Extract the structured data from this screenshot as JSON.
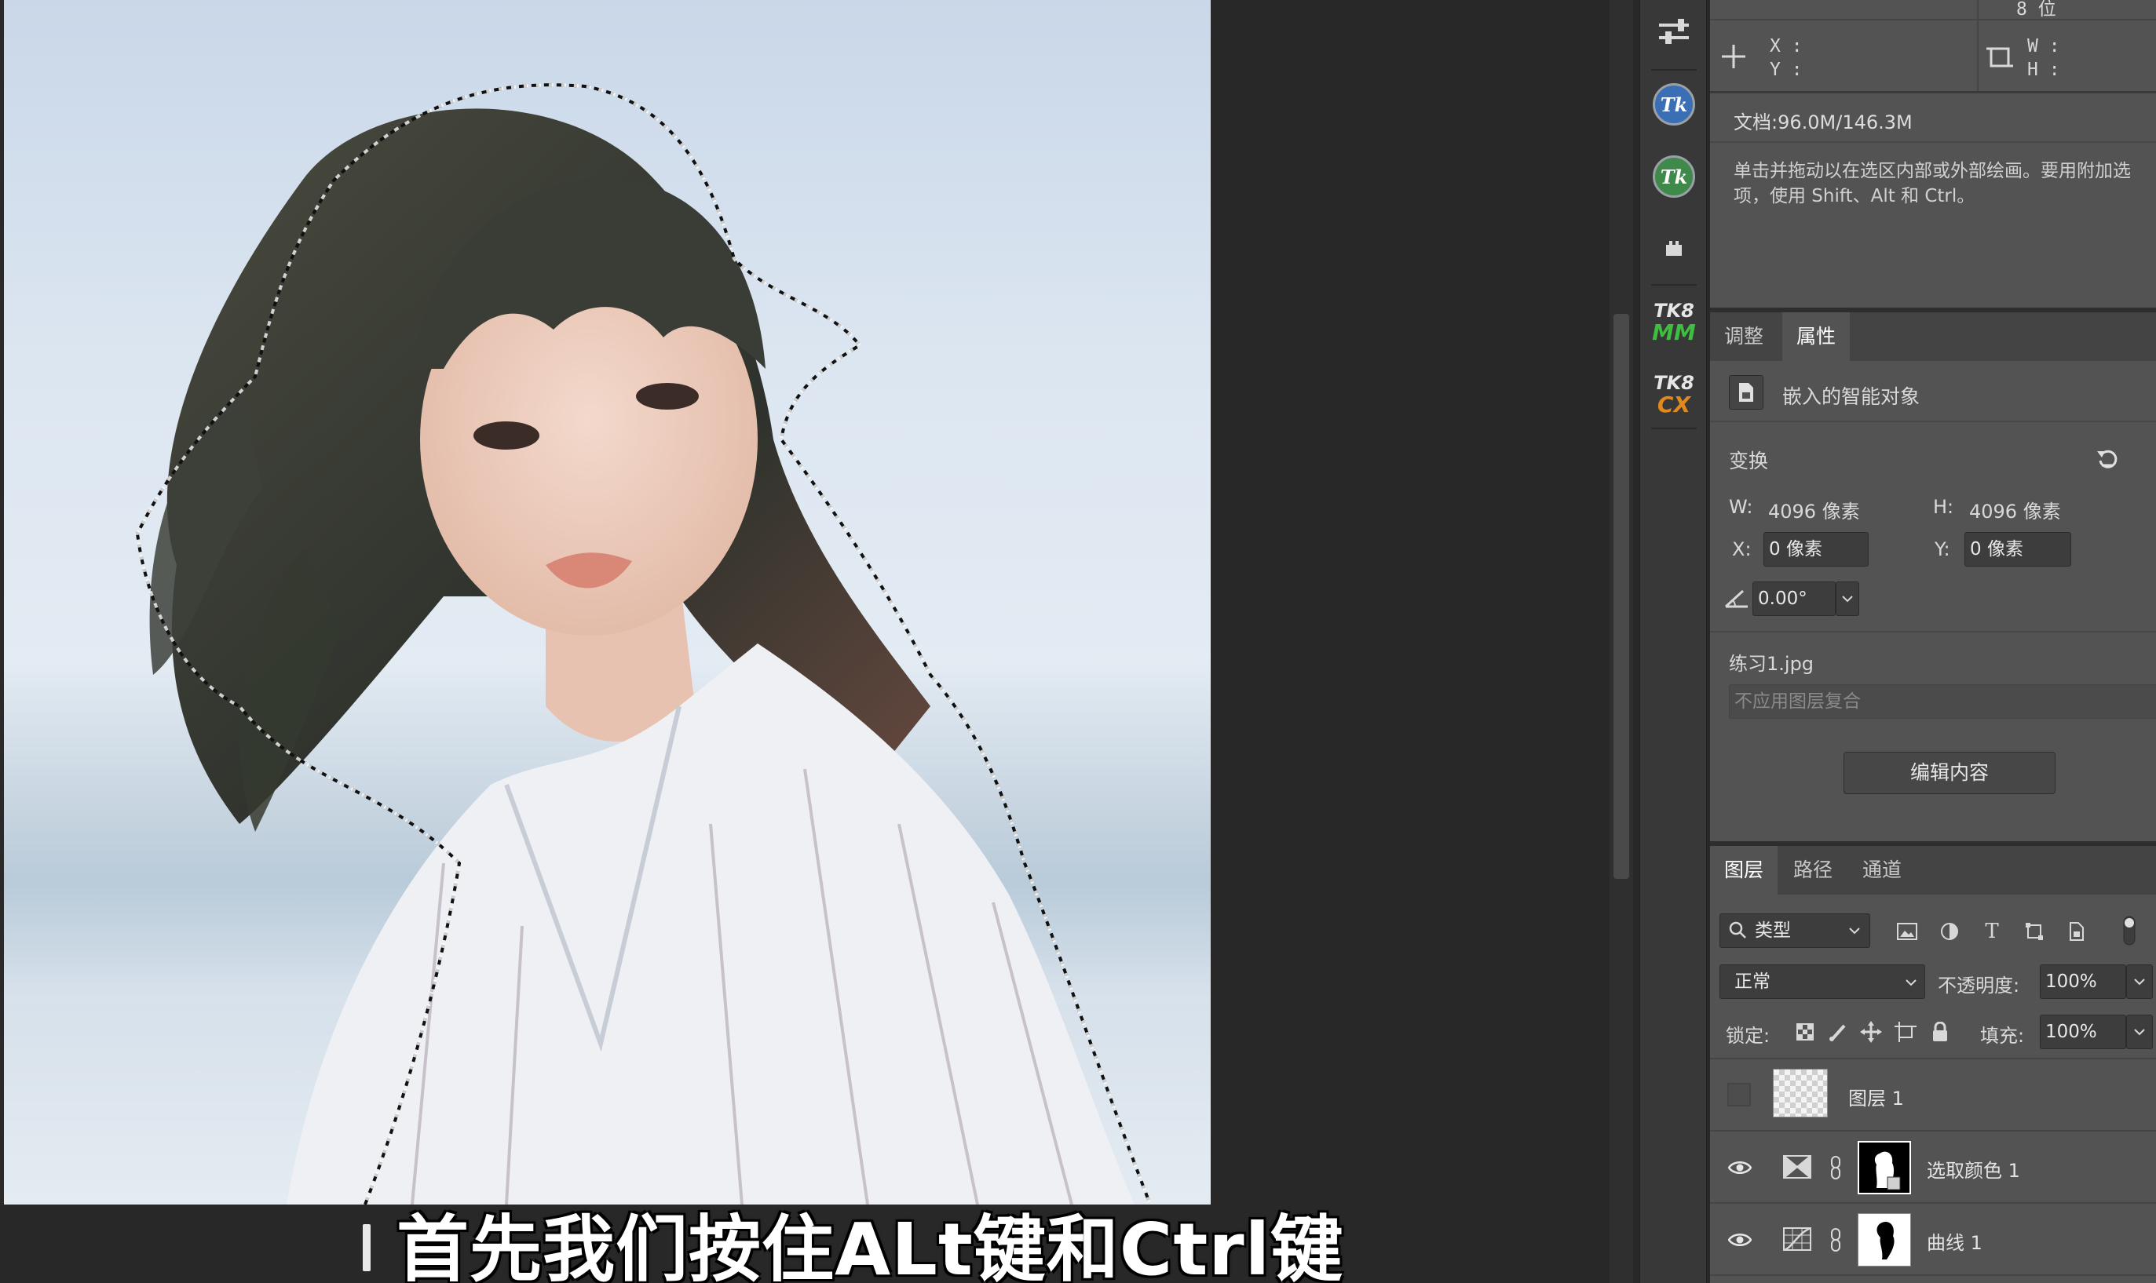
{
  "subtitle": "首先我们按住ALt键和Ctrl键",
  "info": {
    "x_label": "X :",
    "y_label": "Y :",
    "w_label": "W :",
    "h_label": "H :",
    "bit_depth": "8 位",
    "doc_size": "文档:96.0M/146.3M",
    "hint": "单击并拖动以在选区内部或外部绘画。要用附加选项，使用 Shift、Alt 和 Ctrl。"
  },
  "tools": [
    {
      "name": "adjust-sliders-icon"
    },
    {
      "name": "tk7-icon",
      "label": "Tk",
      "color": "#3b6fb5"
    },
    {
      "name": "tk7-green-icon",
      "label": "Tk",
      "color": "#3f8a4a"
    },
    {
      "name": "plugin-icon"
    },
    {
      "name": "tk8-mm-icon",
      "top": "TK8",
      "bottom": "MM"
    },
    {
      "name": "tk8-cx-icon",
      "top": "TK8",
      "bottom": "CX"
    }
  ],
  "properties": {
    "tabs": [
      "调整",
      "属性"
    ],
    "active_tab": "属性",
    "object_type": "嵌入的智能对象",
    "section_transform": "变换",
    "w_label": "W:",
    "w_value": "4096 像素",
    "h_label": "H:",
    "h_value": "4096 像素",
    "x_label": "X:",
    "x_value": "0 像素",
    "y_label": "Y:",
    "y_value": "0 像素",
    "angle_value": "0.00°",
    "file_name": "练习1.jpg",
    "layer_comp_placeholder": "不应用图层复合",
    "edit_button": "编辑内容"
  },
  "layers": {
    "tabs": [
      "图层",
      "路径",
      "通道"
    ],
    "active_tab": "图层",
    "filter_kind": "类型",
    "blend_mode": "正常",
    "opacity_label": "不透明度:",
    "opacity_value": "100%",
    "lock_label": "锁定:",
    "fill_label": "填充:",
    "fill_value": "100%",
    "items": [
      {
        "name": "图层 1",
        "visible": false
      },
      {
        "name": "选取颜色 1",
        "visible": true
      },
      {
        "name": "曲线 1",
        "visible": true
      }
    ]
  }
}
